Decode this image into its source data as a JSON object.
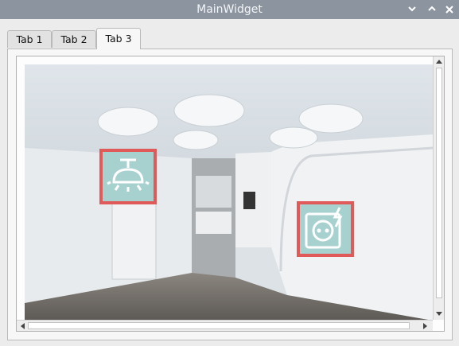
{
  "window": {
    "title": "MainWidget"
  },
  "tabs": [
    {
      "label": "Tab 1"
    },
    {
      "label": "Tab 2"
    },
    {
      "label": "Tab 3",
      "active": true
    }
  ],
  "content": {
    "image": "room-interior-photo",
    "hotspots": [
      {
        "icon": "ceiling-lamp-icon"
      },
      {
        "icon": "power-outlet-icon"
      }
    ]
  },
  "colors": {
    "titlebar": "#8c959f",
    "hotspot_border": "#e05a5a",
    "hotspot_fill": "#a7d1cf"
  }
}
